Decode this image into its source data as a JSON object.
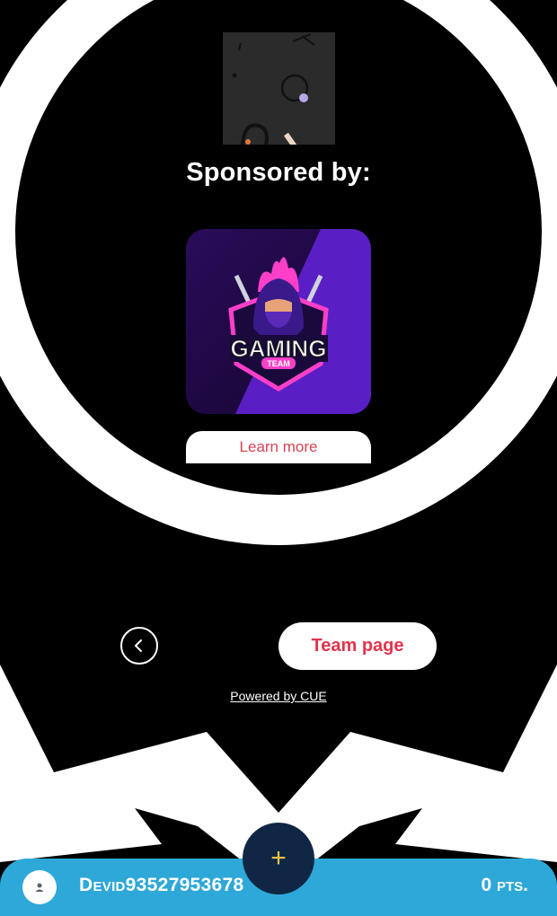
{
  "sponsor": {
    "heading": "Sponsored by:",
    "logo_text": "GAMING",
    "logo_subtext": "TEAM",
    "learn_more_label": "Learn more"
  },
  "nav": {
    "back_icon": "chevron-left-icon",
    "team_page_label": "Team page"
  },
  "footer": {
    "powered_by": "Powered by CUE"
  },
  "fab": {
    "icon": "+"
  },
  "user": {
    "name": "Devid93527953678",
    "points": "0 pts."
  },
  "colors": {
    "accent": "#e2334b",
    "bar": "#2ea8d8",
    "fab": "#0f2744"
  }
}
